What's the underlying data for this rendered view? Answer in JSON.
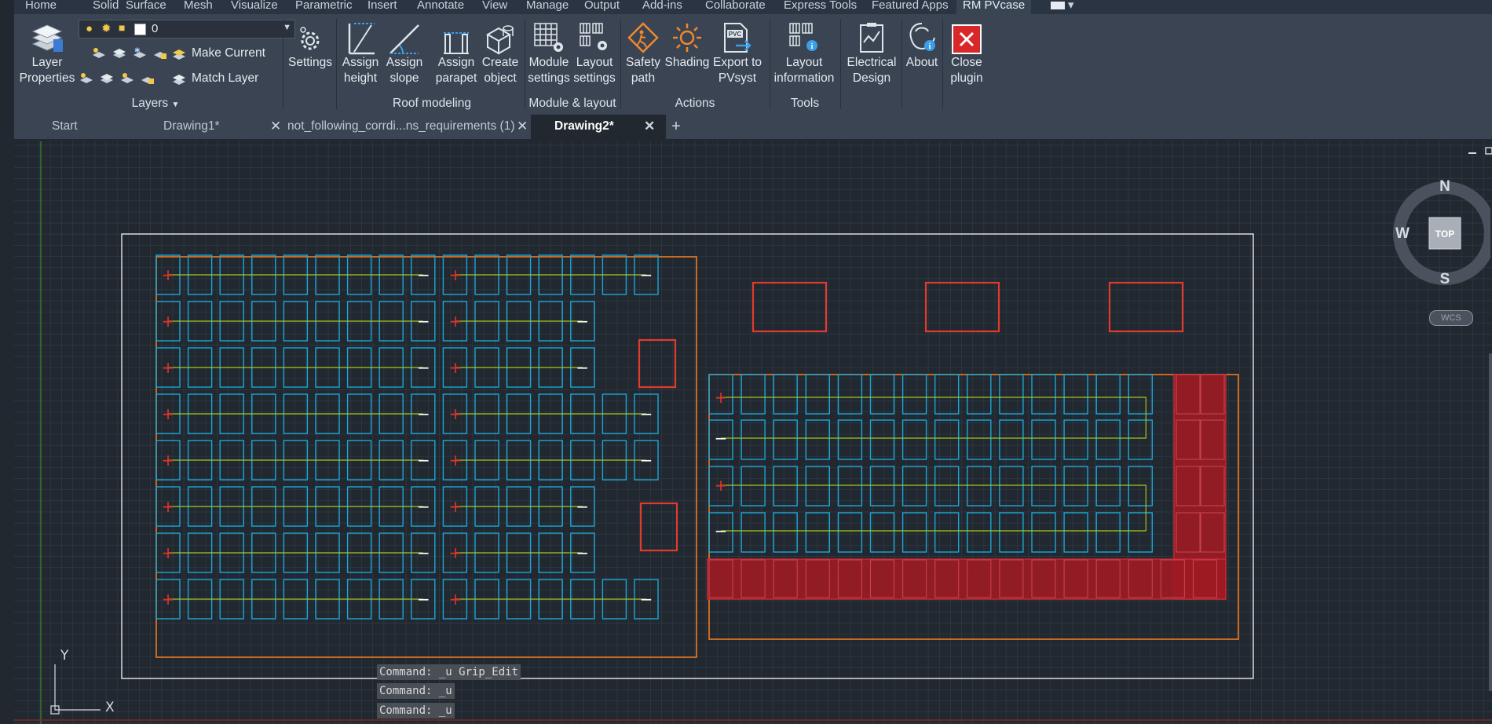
{
  "menu": {
    "items": [
      "Home",
      "Solid",
      "Surface",
      "Mesh",
      "Visualize",
      "Parametric",
      "Insert",
      "Annotate",
      "View",
      "Manage",
      "Output",
      "Add-ins",
      "Collaborate",
      "Express Tools",
      "Featured Apps",
      "RM PVcase"
    ],
    "active": "RM PVcase"
  },
  "ribbon": {
    "layers": {
      "layer_properties_line1": "Layer",
      "layer_properties_line2": "Properties",
      "current_layer": "0",
      "make_current": "Make Current",
      "match_layer": "Match Layer",
      "panel_title": "Layers"
    },
    "settings": {
      "label": "Settings"
    },
    "roof_modeling": {
      "assign_height": [
        "Assign",
        "height"
      ],
      "assign_slope": [
        "Assign",
        "slope"
      ],
      "assign_parapet": [
        "Assign",
        "parapet"
      ],
      "create_object": [
        "Create",
        "object"
      ],
      "panel_title": "Roof modeling"
    },
    "module_layout": {
      "module_settings": [
        "Module",
        "settings"
      ],
      "layout_settings": [
        "Layout",
        "settings"
      ],
      "panel_title": "Module & layout"
    },
    "actions": {
      "safety_path": [
        "Safety",
        "path"
      ],
      "shading": [
        "Shading"
      ],
      "export_pvsyst": [
        "Export to",
        "PVsyst"
      ],
      "export_icon_text": "PVC",
      "panel_title": "Actions"
    },
    "tools": {
      "layout_information": [
        "Layout",
        "information"
      ],
      "panel_title": "Tools"
    },
    "electrical_design": [
      "Electrical",
      "Design"
    ],
    "about": [
      "About"
    ],
    "close_plugin": [
      "Close",
      "plugin"
    ]
  },
  "tabs": [
    {
      "label": "Start",
      "active": false,
      "closable": false
    },
    {
      "label": "Drawing1*",
      "active": false,
      "closable": true
    },
    {
      "label": "not_following_corrdi...ns_requirements (1)",
      "active": false,
      "closable": true
    },
    {
      "label": "Drawing2*",
      "active": true,
      "closable": true
    }
  ],
  "tab_add": "+",
  "tab_close_glyph": "✕",
  "viewcube": {
    "north": "N",
    "south": "S",
    "west": "W",
    "top": "TOP",
    "wcs": "WCS"
  },
  "ucs": {
    "x": "X",
    "y": "Y"
  },
  "command_history": [
    "Command: _u Grip_Edit",
    "Command: _u",
    "Command: _u"
  ],
  "pv_symbols": {
    "plus": "+",
    "minus": "−"
  },
  "colors": {
    "module": "#1ba7d6",
    "string_wire": "#a8c81e",
    "obstacle": "#e23b2e",
    "excluded_fill": "#9e1b22",
    "roof_outline": "#f07a1b",
    "boundary": "#e8e8e8",
    "background": "#212830",
    "grid": "#2f3844"
  }
}
